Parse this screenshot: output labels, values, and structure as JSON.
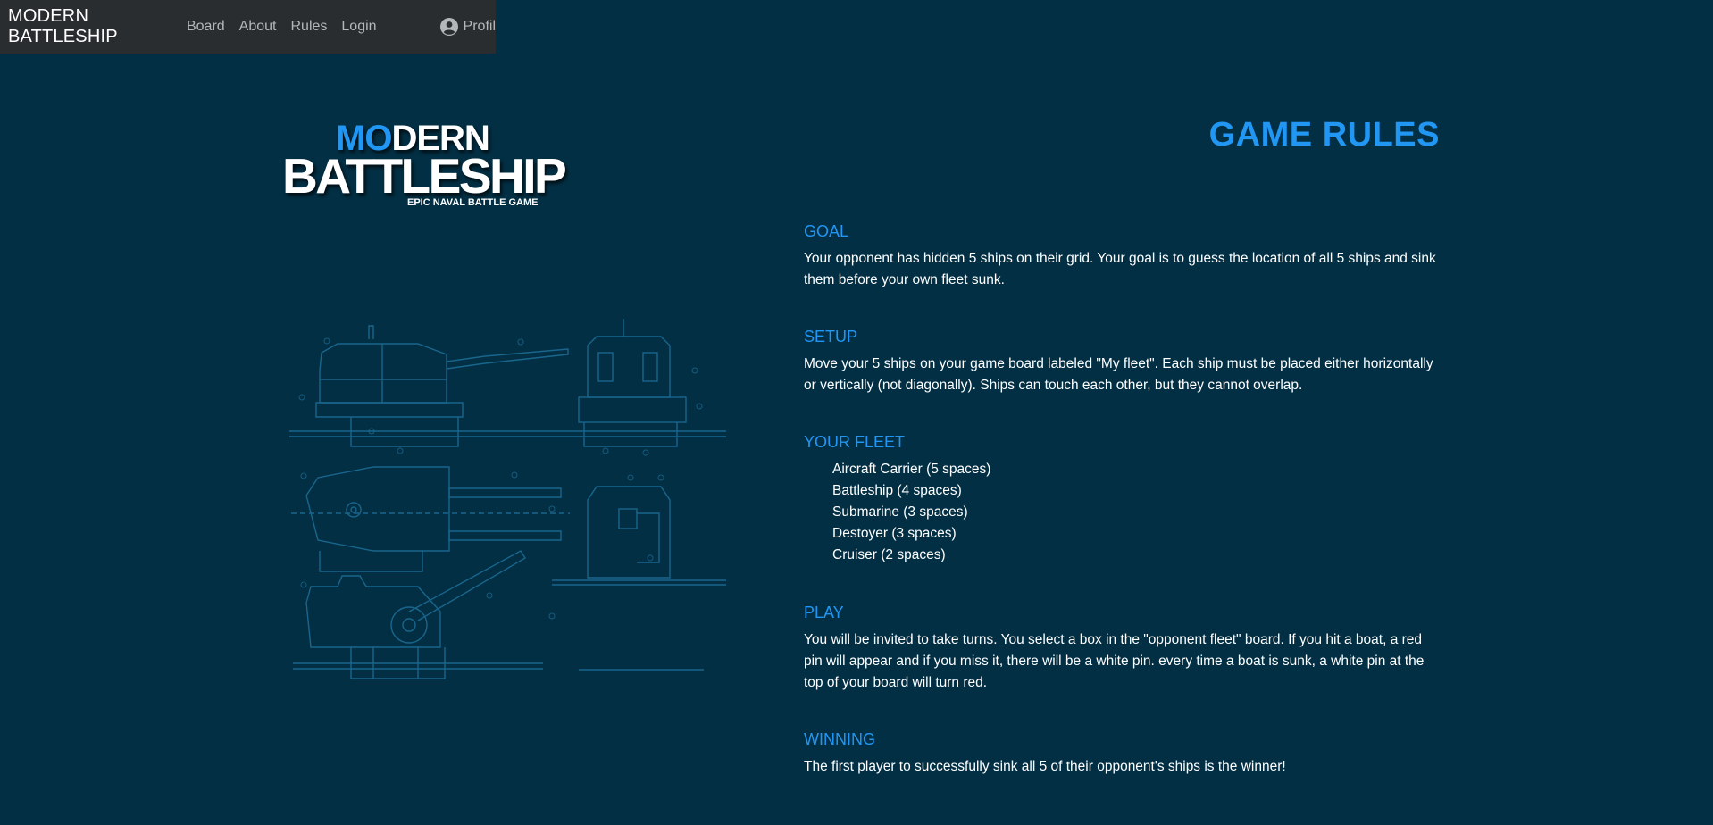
{
  "nav": {
    "brand": "MODERN BATTLESHIP",
    "links": [
      "Board",
      "About",
      "Rules",
      "Login"
    ],
    "profile_label": "Profil",
    "profile_icon": "user-circle-icon"
  },
  "logo": {
    "line1_accent": "MO",
    "line1_rest": "DERN",
    "line2": "BATTLESHIP",
    "tagline": "EPIC NAVAL BATTLE GAME"
  },
  "rules": {
    "title": "GAME RULES",
    "goal": {
      "heading": "GOAL",
      "text": "Your opponent has hidden 5 ships on their grid. Your goal is to guess the location of all 5 ships and sink them before your own fleet sunk."
    },
    "setup": {
      "heading": "SETUP",
      "text": "Move your 5 ships on your game board labeled \"My fleet\". Each ship must be placed either horizontally or vertically (not diagonally). Ships can touch each other, but they cannot overlap."
    },
    "fleet": {
      "heading": "YOUR FLEET",
      "items": [
        "Aircraft Carrier (5 spaces)",
        "Battleship (4 spaces)",
        "Submarine (3 spaces)",
        "Destoyer (3 spaces)",
        "Cruiser (2 spaces)"
      ]
    },
    "play": {
      "heading": "PLAY",
      "text": "You will be invited to take turns. You select a box in the \"opponent fleet\" board. If you hit a boat, a red pin will appear and if you miss it, there will be a white pin. every time a boat is sunk, a white pin at the top of your board will turn red."
    },
    "winning": {
      "heading": "WINNING",
      "text": "The first player to successfully sink all 5 of their opponent's ships is the winner!"
    }
  },
  "colors": {
    "background": "#022f44",
    "navbar": "#2a2d30",
    "accent": "#2196f3",
    "text": "#ffffff",
    "nav_link": "#b4b7ba"
  }
}
